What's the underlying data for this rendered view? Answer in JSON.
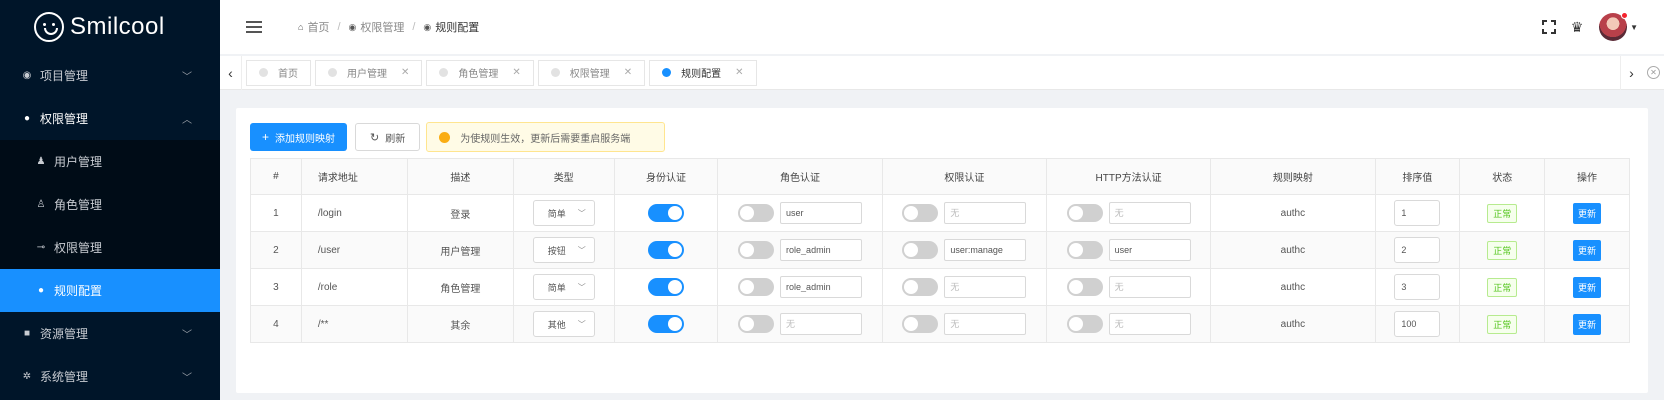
{
  "app": {
    "logo_text": "Smilcool"
  },
  "sidebar": {
    "items": [
      {
        "label": "项目管理",
        "icon": "globe-icon",
        "chevron": "⌄"
      },
      {
        "label": "权限管理",
        "icon": "shield-icon",
        "chevron": "⌃"
      },
      {
        "label": "资源管理",
        "icon": "folder-icon",
        "chevron": "⌄"
      },
      {
        "label": "系统管理",
        "icon": "gear-icon",
        "chevron": "⌄"
      }
    ],
    "submenu": [
      {
        "label": "用户管理",
        "icon": "user-icon"
      },
      {
        "label": "角色管理",
        "icon": "users-icon"
      },
      {
        "label": "权限管理",
        "icon": "key-icon"
      },
      {
        "label": "规则配置",
        "icon": "rule-icon"
      }
    ]
  },
  "header": {
    "breadcrumb": [
      {
        "label": "首页",
        "icon": "home-icon"
      },
      {
        "label": "权限管理",
        "icon": "shield-icon"
      },
      {
        "label": "规则配置",
        "icon": "rule-icon"
      }
    ]
  },
  "tabs": [
    {
      "label": "首页",
      "closable": false
    },
    {
      "label": "用户管理",
      "closable": true
    },
    {
      "label": "角色管理",
      "closable": true
    },
    {
      "label": "权限管理",
      "closable": true
    },
    {
      "label": "规则配置",
      "closable": true,
      "active": true
    }
  ],
  "toolbar": {
    "add_label": "添加规则映射",
    "refresh_label": "刷新",
    "alert_text": "为使规则生效，更新后需要重启服务端"
  },
  "table": {
    "headers": [
      "#",
      "请求地址",
      "描述",
      "类型",
      "身份认证",
      "角色认证",
      "权限认证",
      "HTTP方法认证",
      "规则映射",
      "排序值",
      "状态",
      "操作"
    ],
    "rows": [
      {
        "index": "1",
        "path": "/login",
        "desc": "登录",
        "type": "简单",
        "identity_on": true,
        "role_on": false,
        "role_value": "user",
        "perm_on": false,
        "perm_value": "",
        "http_on": false,
        "http_value": "",
        "mapping": "authc",
        "sort": "1",
        "status": "正常",
        "action": "更新"
      },
      {
        "index": "2",
        "path": "/user",
        "desc": "用户管理",
        "type": "按钮",
        "identity_on": true,
        "role_on": false,
        "role_value": "role_admin",
        "perm_on": false,
        "perm_value": "user:manage",
        "http_on": false,
        "http_value": "user",
        "mapping": "authc",
        "sort": "2",
        "status": "正常",
        "action": "更新"
      },
      {
        "index": "3",
        "path": "/role",
        "desc": "角色管理",
        "type": "简单",
        "identity_on": true,
        "role_on": false,
        "role_value": "role_admin",
        "perm_on": false,
        "perm_value": "",
        "http_on": false,
        "http_value": "",
        "mapping": "authc",
        "sort": "3",
        "status": "正常",
        "action": "更新"
      },
      {
        "index": "4",
        "path": "/**",
        "desc": "其余",
        "type": "其他",
        "identity_on": true,
        "role_on": false,
        "role_value": "",
        "perm_on": false,
        "perm_value": "",
        "http_on": false,
        "http_value": "",
        "mapping": "authc",
        "sort": "100",
        "status": "正常",
        "action": "更新"
      }
    ],
    "empty_placeholder": "无"
  },
  "colors": {
    "sidebar_bg": "#001529",
    "accent": "#1890ff",
    "success": "#52c41a",
    "warning": "#faad14"
  }
}
